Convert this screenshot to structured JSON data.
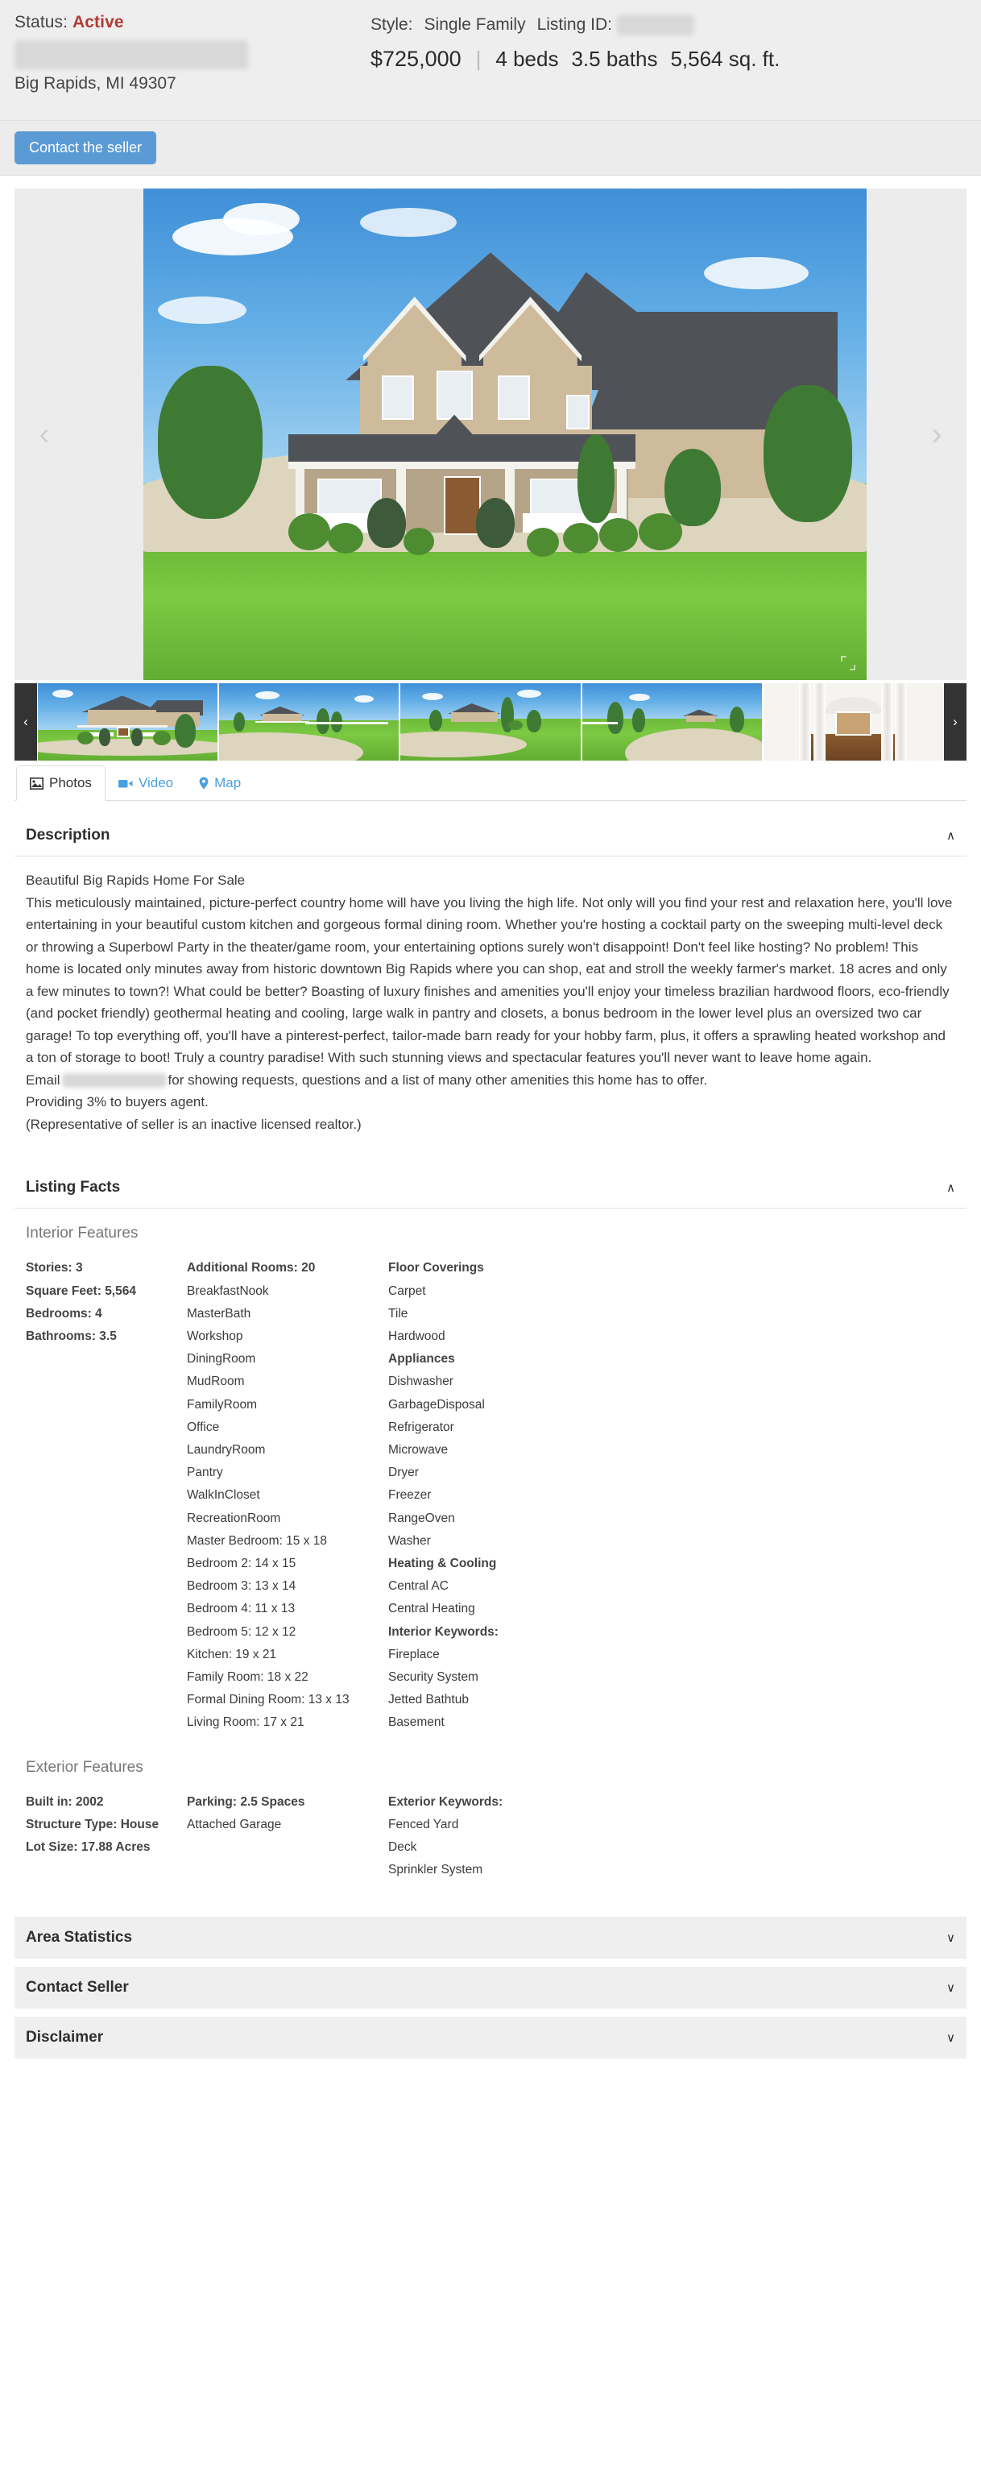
{
  "header": {
    "status_label": "Status:",
    "status_value": "Active",
    "address_redacted": true,
    "city_state_zip": "Big Rapids, MI 49307",
    "style_label": "Style:",
    "style_value": "Single Family",
    "listing_id_label": "Listing ID:",
    "listing_id_redacted": true,
    "price": "$725,000",
    "beds": "4 beds",
    "baths": "3.5 baths",
    "sqft": "5,564 sq. ft."
  },
  "cta": {
    "contact_seller": "Contact the seller"
  },
  "gallery": {
    "prev_arrow": "‹",
    "next_arrow": "›",
    "thumb_prev": "‹",
    "thumb_next": "›",
    "thumbnails": [
      {
        "name": "front-exterior"
      },
      {
        "name": "driveway-view-1"
      },
      {
        "name": "driveway-view-2"
      },
      {
        "name": "driveway-view-3"
      },
      {
        "name": "foyer-interior"
      }
    ]
  },
  "tabs": [
    {
      "label": "Photos",
      "icon": "photos-icon",
      "active": true
    },
    {
      "label": "Video",
      "icon": "video-icon",
      "active": false
    },
    {
      "label": "Map",
      "icon": "map-pin-icon",
      "active": false
    }
  ],
  "description": {
    "title": "Description",
    "chevron": "∧",
    "headline": "Beautiful Big Rapids Home For Sale",
    "body_part1": "This meticulously maintained, picture-perfect country home will have you living the high life. Not only will you find your rest and relaxation here, you'll love entertaining in your beautiful custom kitchen and gorgeous formal dining room. Whether you're hosting a cocktail party on the sweeping multi-level deck or throwing a Superbowl Party in the theater/game room, your entertaining options surely won't disappoint! Don't feel like hosting? No problem! This home is located only minutes away from historic downtown Big Rapids where you can shop, eat and stroll the weekly farmer's market. 18 acres and only a few minutes to town?! What could be better? Boasting of luxury finishes and amenities you'll enjoy your timeless brazilian hardwood floors, eco-friendly (and pocket friendly) geothermal heating and cooling, large walk in pantry and closets, a bonus bedroom in the lower level plus an oversized two car garage! To top everything off, you'll have a pinterest-perfect, tailor-made barn ready for your hobby farm, plus, it offers a sprawling heated workshop and a ton of storage to boot! Truly a country paradise! With such stunning views and spectacular features you'll never want to leave home again.",
    "email_prefix": "Email",
    "email_redacted": true,
    "email_suffix": "for showing requests, questions and a list of many other amenities this home has to offer.",
    "line_buyers_agent": "Providing 3% to buyers agent.",
    "line_representative": "(Representative of seller is an inactive licensed realtor.)"
  },
  "listing_facts": {
    "title": "Listing Facts",
    "chevron": "∧",
    "interior_title": "Interior Features",
    "exterior_title": "Exterior Features",
    "interior_col1": [
      "Stories: 3",
      "Square Feet: 5,564",
      "Bedrooms: 4",
      "Bathrooms: 3.5"
    ],
    "interior_col2_head": "Additional Rooms: 20",
    "interior_col2": [
      "BreakfastNook",
      "MasterBath",
      "Workshop",
      "DiningRoom",
      "MudRoom",
      "FamilyRoom",
      "Office",
      "LaundryRoom",
      "Pantry",
      "WalkInCloset",
      "RecreationRoom",
      "Master Bedroom: 15 x 18",
      "Bedroom 2: 14 x 15",
      "Bedroom 3: 13 x 14",
      "Bedroom 4: 11 x 13",
      "Bedroom 5: 12 x 12",
      "Kitchen: 19 x 21",
      "Family Room: 18 x 22",
      "Formal Dining Room: 13 x 13",
      "Living Room: 17 x 21"
    ],
    "interior_col3_groups": [
      {
        "head": "Floor Coverings",
        "items": [
          "Carpet",
          "Tile",
          "Hardwood"
        ]
      },
      {
        "head": "Appliances",
        "items": [
          "Dishwasher",
          "GarbageDisposal",
          "Refrigerator",
          "Microwave",
          "Dryer",
          "Freezer",
          "RangeOven",
          "Washer"
        ]
      },
      {
        "head": "Heating & Cooling",
        "items": [
          "Central AC",
          "Central Heating"
        ]
      },
      {
        "head": "Interior Keywords:",
        "items": [
          "Fireplace",
          "Security System",
          "Jetted Bathtub",
          "Basement"
        ]
      }
    ],
    "exterior_col1": [
      "Built in: 2002",
      "Structure Type: House",
      "Lot Size: 17.88 Acres"
    ],
    "exterior_col2_head": "Parking: 2.5 Spaces",
    "exterior_col2": [
      "Attached Garage"
    ],
    "exterior_col3_head": "Exterior Keywords:",
    "exterior_col3": [
      "Fenced Yard",
      "Deck",
      "Sprinkler System"
    ]
  },
  "collapsed_sections": [
    {
      "title": "Area Statistics",
      "chevron": "∨"
    },
    {
      "title": "Contact Seller",
      "chevron": "∨"
    },
    {
      "title": "Disclaimer",
      "chevron": "∨"
    }
  ]
}
